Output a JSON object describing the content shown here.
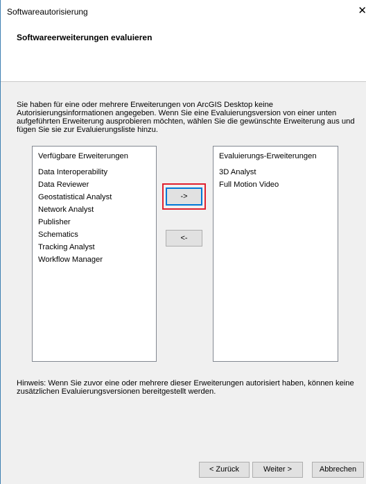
{
  "window": {
    "title": "Softwareautorisierung",
    "close_glyph": "✕"
  },
  "header": {
    "title": "Softwareerweiterungen evaluieren"
  },
  "intro_text": "Sie haben für eine oder mehrere Erweiterungen von ArcGIS Desktop keine Autorisierungsinformationen angegeben. Wenn Sie eine Evaluierungsversion von einer unten aufgeführten Erweiterung ausprobieren möchten, wählen Sie die gewünschte Erweiterung aus und fügen Sie sie zur Evaluierungsliste hinzu.",
  "available": {
    "header": "Verfügbare Erweiterungen",
    "items": [
      {
        "label": "Data Interoperability"
      },
      {
        "label": "Data Reviewer"
      },
      {
        "label": "Geostatistical Analyst"
      },
      {
        "label": "Network Analyst"
      },
      {
        "label": "Publisher"
      },
      {
        "label": "Schematics"
      },
      {
        "label": "Tracking Analyst"
      },
      {
        "label": "Workflow Manager"
      }
    ]
  },
  "evaluation": {
    "header": "Evaluierungs-Erweiterungen",
    "items": [
      {
        "label": "3D Analyst"
      },
      {
        "label": "Full Motion Video"
      }
    ]
  },
  "buttons": {
    "add": "->",
    "remove": "<-",
    "back": "< Zurück",
    "next": "Weiter >",
    "cancel": "Abbrechen"
  },
  "hint_text": "Hinweis: Wenn Sie zuvor eine oder mehrere dieser Erweiterungen autorisiert haben, können keine zusätzlichen Evaluierungsversionen bereitgestellt werden.",
  "colors": {
    "highlight": "#e0202e",
    "focus": "#0078d7"
  }
}
